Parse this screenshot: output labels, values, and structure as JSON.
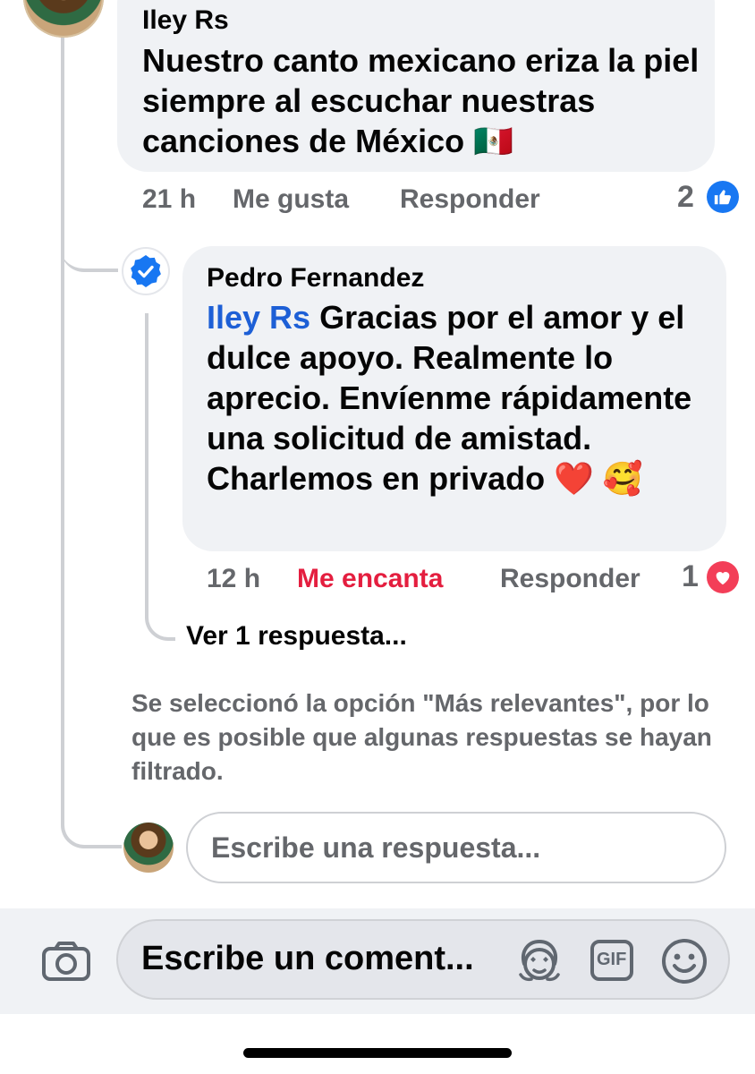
{
  "parent_comment": {
    "author": "Iley Rs",
    "text": "Nuestro canto mexicano eriza la piel siempre al escuchar nuestras canciones de México 🇲🇽",
    "time": "21 h",
    "like_label": "Me gusta",
    "reply_label": "Responder",
    "reaction_count": "2",
    "reaction_icon": "like-icon"
  },
  "reply_comment": {
    "author": "Pedro Fernandez",
    "mention": "Iley Rs",
    "text": "Gracias por el amor y el dulce apoyo. Realmente lo aprecio. Envíenme rápidamente una solicitud de amistad. Charlemos en privado ❤️ 🥰",
    "time": "12 h",
    "reaction_label": "Me encanta",
    "reply_label": "Responder",
    "reaction_count": "1",
    "reaction_icon": "love-icon",
    "verified_icon": "verified-badge-icon"
  },
  "view_replies": "Ver 1 respuesta...",
  "notice": "Se seleccionó la opción \"Más relevantes\", por lo que es posible que algunas respuestas se hayan filtrado.",
  "reply_input": {
    "placeholder": "Escribe una respuesta..."
  },
  "comment_bar": {
    "placeholder": "Escribe un coment...",
    "camera_icon": "camera-icon",
    "avatar_sticker_icon": "avatar-sticker-icon",
    "gif_label": "GIF",
    "emoji_icon": "emoji-icon"
  },
  "colors": {
    "accent_blue": "#1877f2",
    "mention_blue": "#1d5fd6",
    "love_red": "#e41e3f",
    "secondary_text": "#65676b",
    "bubble_bg": "#f0f2f5"
  }
}
